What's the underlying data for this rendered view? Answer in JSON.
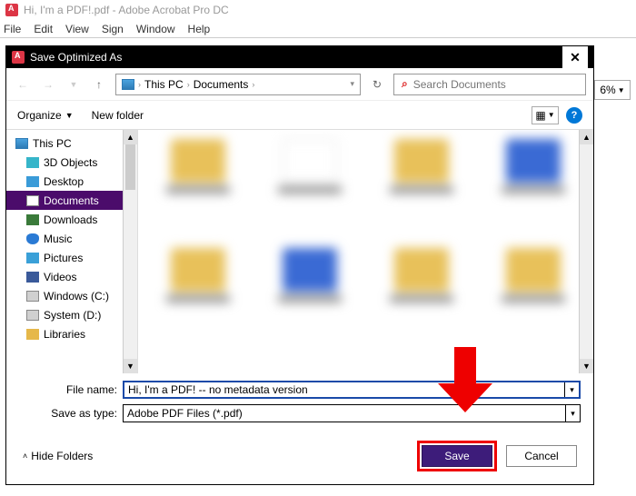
{
  "app": {
    "title": "Hi, I'm a PDF!.pdf - Adobe Acrobat Pro DC",
    "menu": [
      "File",
      "Edit",
      "View",
      "Sign",
      "Window",
      "Help"
    ],
    "zoom": "6%"
  },
  "dialog": {
    "title": "Save Optimized As",
    "breadcrumb": {
      "root": "This PC",
      "folder": "Documents"
    },
    "search_placeholder": "Search Documents",
    "organize": "Organize",
    "new_folder": "New folder",
    "tree": [
      {
        "label": "This PC",
        "icon": "pc",
        "top": true
      },
      {
        "label": "3D Objects",
        "icon": "3d"
      },
      {
        "label": "Desktop",
        "icon": "desk"
      },
      {
        "label": "Documents",
        "icon": "doc",
        "selected": true
      },
      {
        "label": "Downloads",
        "icon": "dl"
      },
      {
        "label": "Music",
        "icon": "music"
      },
      {
        "label": "Pictures",
        "icon": "pic"
      },
      {
        "label": "Videos",
        "icon": "vid"
      },
      {
        "label": "Windows (C:)",
        "icon": "drive"
      },
      {
        "label": "System (D:)",
        "icon": "drive"
      },
      {
        "label": "Libraries",
        "icon": "lib"
      }
    ],
    "file_name_label": "File name:",
    "file_name": "Hi, I'm a PDF! -- no metadata version",
    "save_type_label": "Save as type:",
    "save_type": "Adobe PDF Files (*.pdf)",
    "hide_folders": "Hide Folders",
    "save": "Save",
    "cancel": "Cancel",
    "help": "?"
  }
}
